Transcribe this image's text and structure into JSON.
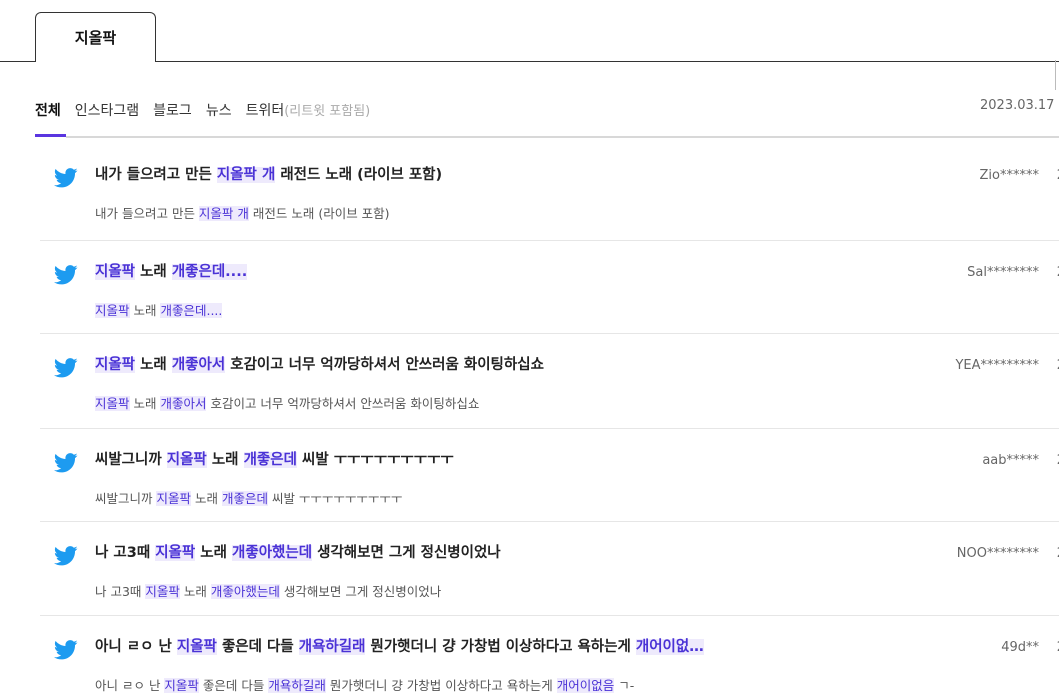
{
  "top_tab": {
    "label": "지올팍"
  },
  "filters": [
    {
      "label": "전체",
      "active": true
    },
    {
      "label": "인스타그램",
      "active": false
    },
    {
      "label": "블로그",
      "active": false
    },
    {
      "label": "뉴스",
      "active": false
    },
    {
      "label": "트위터",
      "note": "(리트윗 포함됨)",
      "active": false
    }
  ],
  "date": "2023.03.17",
  "items": [
    {
      "title": [
        [
          "내가 들으려고 만든 ",
          false
        ],
        [
          "지올팍 개",
          true
        ],
        [
          " 래전드 노래 (라이브 포함)",
          false
        ]
      ],
      "snippet": [
        [
          "내가 들으려고 만든 ",
          false
        ],
        [
          "지올팍 개",
          true
        ],
        [
          " 래전드 노래 (라이브 포함)",
          false
        ]
      ],
      "author": "Zio******",
      "cut": "2"
    },
    {
      "title": [
        [
          "지올팍",
          true
        ],
        [
          " 노래 ",
          false
        ],
        [
          "개좋은데....",
          true
        ]
      ],
      "snippet": [
        [
          "지올팍",
          true
        ],
        [
          " 노래 ",
          false
        ],
        [
          "개좋은데....",
          true
        ]
      ],
      "author": "Sal********",
      "cut": "2"
    },
    {
      "title": [
        [
          "지올팍",
          true
        ],
        [
          " 노래 ",
          false
        ],
        [
          "개좋아서",
          true
        ],
        [
          " 호감이고 너무 억까당하셔서 안쓰러움 화이팅하십쇼",
          false
        ]
      ],
      "snippet": [
        [
          "지올팍",
          true
        ],
        [
          " 노래 ",
          false
        ],
        [
          "개좋아서",
          true
        ],
        [
          " 호감이고 너무 억까당하셔서 안쓰러움 화이팅하십쇼",
          false
        ]
      ],
      "author": "YEA*********",
      "cut": "2"
    },
    {
      "title": [
        [
          "씨발그니까 ",
          false
        ],
        [
          "지올팍",
          true
        ],
        [
          " 노래 ",
          false
        ],
        [
          "개좋은데",
          true
        ],
        [
          " 씨발 ㅜㅜㅜㅜㅜㅜㅜㅜㅜ",
          false
        ]
      ],
      "snippet": [
        [
          "씨발그니까 ",
          false
        ],
        [
          "지올팍",
          true
        ],
        [
          " 노래 ",
          false
        ],
        [
          "개좋은데",
          true
        ],
        [
          " 씨발 ㅜㅜㅜㅜㅜㅜㅜㅜㅜ",
          false
        ]
      ],
      "author": "aab*****",
      "cut": "2"
    },
    {
      "title": [
        [
          "나 고3때 ",
          false
        ],
        [
          "지올팍",
          true
        ],
        [
          " 노래 ",
          false
        ],
        [
          "개좋아했는데",
          true
        ],
        [
          " 생각해보면 그게 정신병이었나",
          false
        ]
      ],
      "snippet": [
        [
          "나 고3때 ",
          false
        ],
        [
          "지올팍",
          true
        ],
        [
          " 노래 ",
          false
        ],
        [
          "개좋아했는데",
          true
        ],
        [
          " 생각해보면 그게 정신병이었나",
          false
        ]
      ],
      "author": "NOO********",
      "cut": "2"
    },
    {
      "title": [
        [
          "아니 ㄹㅇ 난 ",
          false
        ],
        [
          "지올팍",
          true
        ],
        [
          " 좋은데 다들 ",
          false
        ],
        [
          "개욕하길래",
          true
        ],
        [
          " 뭔가햇더니 걍 가창법 이상하다고 욕하는게 ",
          false
        ],
        [
          "개어이없…",
          true
        ]
      ],
      "snippet": [
        [
          "아니 ㄹㅇ 난 ",
          false
        ],
        [
          "지올팍",
          true
        ],
        [
          " 좋은데 다들 ",
          false
        ],
        [
          "개욕하길래",
          true
        ],
        [
          " 뭔가햇더니 걍 가창법 이상하다고 욕하는게 ",
          false
        ],
        [
          "개어이없음",
          true
        ],
        [
          " ㄱ-",
          false
        ]
      ],
      "author": "49d**",
      "cut": "2"
    }
  ],
  "colors": {
    "accent": "#5a35e0",
    "highlight_text": "#4a32d6",
    "highlight_bg": "#eeeafc",
    "twitter": "#1d9bf0"
  },
  "icons": {
    "item": "twitter-bird-icon"
  }
}
